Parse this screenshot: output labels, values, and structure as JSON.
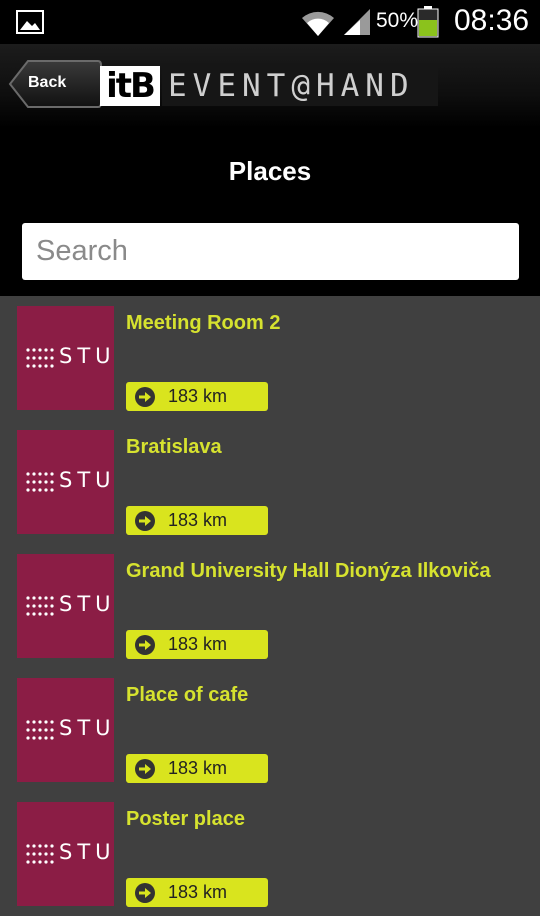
{
  "status_bar": {
    "battery_text": "50%",
    "time": "08:36",
    "icons": [
      "gallery-icon",
      "wifi-icon",
      "signal-icon",
      "battery-icon"
    ]
  },
  "header": {
    "back_label": "Back",
    "logo_prefix": "itB",
    "logo_text": "EVENT@HAND"
  },
  "page": {
    "title": "Places",
    "search_placeholder": "Search"
  },
  "places": [
    {
      "name": "Meeting Room 2",
      "distance": "183 km",
      "logo_text": "STU"
    },
    {
      "name": "Bratislava",
      "distance": "183 km",
      "logo_text": "STU"
    },
    {
      "name": "Grand University Hall Dionýza Ilkoviča",
      "distance": "183 km",
      "logo_text": "STU"
    },
    {
      "name": "Place of cafe",
      "distance": "183 km",
      "logo_text": "STU"
    },
    {
      "name": "Poster place",
      "distance": "183 km",
      "logo_text": "STU"
    }
  ],
  "colors": {
    "accent": "#d9e41e",
    "title_text": "#d6e22f",
    "thumb": "#8b1d45",
    "list_bg": "#404040"
  }
}
